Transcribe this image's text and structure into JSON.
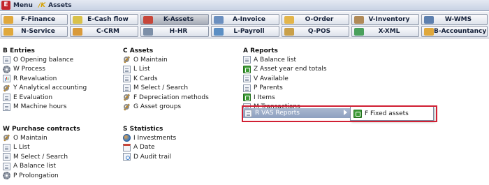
{
  "titlebar": {
    "logo": "E",
    "menu_label": "Menu",
    "crumb_prefix": "/K",
    "crumb_label": "Assets"
  },
  "modules_row1": [
    {
      "label": "F-Finance",
      "icon": "finance-icon",
      "color": "#e0a83c"
    },
    {
      "label": "E-Cash flow",
      "icon": "cash-flow-icon",
      "color": "#d9c14a"
    },
    {
      "label": "K-Assets",
      "icon": "assets-icon",
      "color": "#c7463a",
      "active": true
    },
    {
      "label": "A-Invoice",
      "icon": "invoice-icon",
      "color": "#6b8fbf"
    },
    {
      "label": "O-Order",
      "icon": "order-icon",
      "color": "#e3b54a"
    },
    {
      "label": "V-Inventory",
      "icon": "inventory-icon",
      "color": "#b08a58"
    },
    {
      "label": "W-WMS",
      "icon": "wms-icon",
      "color": "#5d7fae"
    }
  ],
  "modules_row2": [
    {
      "label": "N-Service",
      "icon": "service-icon",
      "color": "#e0a83c"
    },
    {
      "label": "C-CRM",
      "icon": "crm-icon",
      "color": "#d99a3a"
    },
    {
      "label": "H-HR",
      "icon": "hr-icon",
      "color": "#7d8fa8"
    },
    {
      "label": "L-Payroll",
      "icon": "payroll-icon",
      "color": "#5c8fc4"
    },
    {
      "label": "Q-POS",
      "icon": "pos-icon",
      "color": "#c9a04a"
    },
    {
      "label": "X-XML",
      "icon": "xml-icon",
      "color": "#4aa05c"
    },
    {
      "label": "B-Accountancy",
      "icon": "accountancy-icon",
      "color": "#e0a83c"
    }
  ],
  "entries": {
    "title": "B Entries",
    "items": [
      {
        "label": "O Opening balance",
        "icon": "sheet"
      },
      {
        "label": "W Process",
        "icon": "gear"
      },
      {
        "label": "R Revaluation",
        "icon": "chart"
      },
      {
        "label": "Y Analytical accounting",
        "icon": "wrench"
      },
      {
        "label": "E Evaluation",
        "icon": "sheet"
      },
      {
        "label": "M Machine hours",
        "icon": "sheet"
      }
    ]
  },
  "assets": {
    "title": "C Assets",
    "items": [
      {
        "label": "O Maintain",
        "icon": "wrench"
      },
      {
        "label": "L List",
        "icon": "sheet"
      },
      {
        "label": "K Cards",
        "icon": "sheet"
      },
      {
        "label": "M Select / Search",
        "icon": "sheet"
      },
      {
        "label": "F Depreciation methods",
        "icon": "wrench"
      },
      {
        "label": "G Asset groups",
        "icon": "wrench"
      }
    ]
  },
  "reports": {
    "title": "A Reports",
    "items": [
      {
        "label": "A Balance list",
        "icon": "sheet"
      },
      {
        "label": "Z Asset year end totals",
        "icon": "green"
      },
      {
        "label": "V Available",
        "icon": "sheet"
      },
      {
        "label": "P Parents",
        "icon": "sheet"
      },
      {
        "label": "I Items",
        "icon": "green"
      },
      {
        "label": "M Transactions",
        "icon": "sheet"
      }
    ],
    "vas_label": "R VAS Reports",
    "submenu_item": "F Fixed assets"
  },
  "purchase": {
    "title": "W Purchase contracts",
    "items": [
      {
        "label": "O Maintain",
        "icon": "wrench"
      },
      {
        "label": "L List",
        "icon": "sheet"
      },
      {
        "label": "M Select / Search",
        "icon": "sheet"
      },
      {
        "label": "A Balance list",
        "icon": "sheet"
      },
      {
        "label": "P Prolongation",
        "icon": "gear"
      }
    ]
  },
  "statistics": {
    "title": "S Statistics",
    "items": [
      {
        "label": "I Investments",
        "icon": "globe"
      },
      {
        "label": "A Date",
        "icon": "calendar"
      },
      {
        "label": "D Audit trail",
        "icon": "audit"
      }
    ]
  }
}
